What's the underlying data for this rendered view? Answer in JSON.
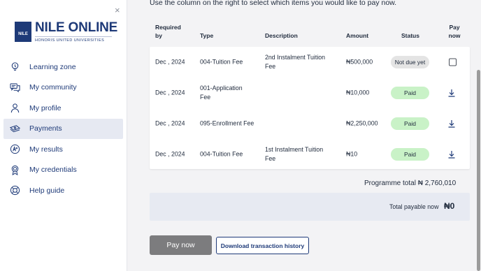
{
  "sidebar": {
    "logo": {
      "title": "NILE ONLINE",
      "shield_text": "NILE",
      "subtitle": "HONORIS UNITED UNIVERSITIES"
    },
    "close_icon": "×",
    "items": [
      {
        "label": "Learning zone",
        "icon": "lightbulb-icon",
        "active": false
      },
      {
        "label": "My community",
        "icon": "chat-bubbles-icon",
        "active": false
      },
      {
        "label": "My profile",
        "icon": "person-icon",
        "active": false
      },
      {
        "label": "Payments",
        "icon": "money-icon",
        "active": true
      },
      {
        "label": "My results",
        "icon": "grade-icon",
        "active": false
      },
      {
        "label": "My credentials",
        "icon": "badge-icon",
        "active": false
      },
      {
        "label": "Help guide",
        "icon": "lifebuoy-icon",
        "active": false
      }
    ]
  },
  "main": {
    "intro": "Use the column on the right to select which items you would like to pay now.",
    "table": {
      "headers": {
        "required_by": "Required by",
        "type": "Type",
        "description": "Description",
        "amount": "Amount",
        "status": "Status",
        "pay_now": "Pay now"
      },
      "rows": [
        {
          "required_by": "Dec , 2024",
          "type": "004-Tuition Fee",
          "description": "2nd Instalment Tuition Fee",
          "amount": "₦500,000",
          "status": "Not due yet",
          "action": "checkbox"
        },
        {
          "required_by": "Dec , 2024",
          "type": "001-Application Fee",
          "description": "",
          "amount": "₦10,000",
          "status": "Paid",
          "action": "download"
        },
        {
          "required_by": "Dec , 2024",
          "type": "095-Enrollment Fee",
          "description": "",
          "amount": "₦2,250,000",
          "status": "Paid",
          "action": "download"
        },
        {
          "required_by": "Dec , 2024",
          "type": "004-Tuition Fee",
          "description": "1st Instalment Tuition Fee",
          "amount": "₦10",
          "status": "Paid",
          "action": "download"
        }
      ]
    },
    "programme_total": "Programme total  ₦ 2,760,010",
    "total_payable_label": "Total payable now",
    "total_payable_value": "₦0",
    "pay_now_button": "Pay now",
    "download_history_button": "Download transaction history"
  },
  "colors": {
    "brand": "#1e3a78",
    "paid_badge": "#c9f2c7",
    "not_due_badge": "#e4e4e4",
    "pay_button": "#7c7c7e",
    "active_nav": "#e6e9f2",
    "payable_box": "#e7eaf2"
  }
}
